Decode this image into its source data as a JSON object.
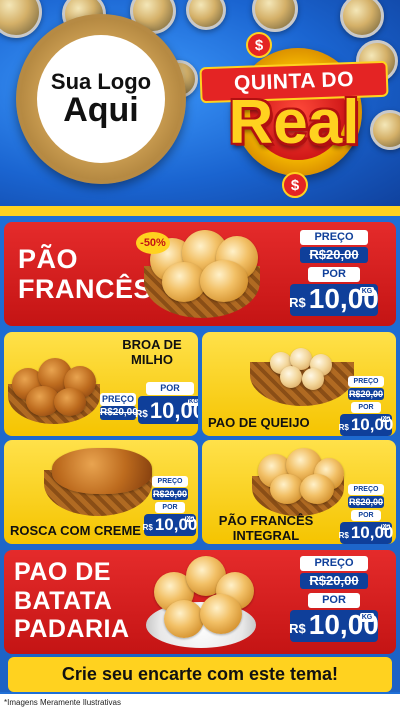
{
  "header": {
    "logo_line1": "Sua Logo",
    "logo_line2": "Aqui",
    "badge_top": "QUINTA DO",
    "badge_main": "Real",
    "badge_symbol": "$"
  },
  "price_labels": {
    "preco": "PREÇO",
    "por": "POR",
    "currency": "R$",
    "unit": "KG"
  },
  "products": {
    "pao_frances": {
      "name_lines": [
        "PÃO",
        "FRANCÊS"
      ],
      "discount": "-50%",
      "old_price": "R$20,00",
      "new_price": "10,00"
    },
    "broa": {
      "name_lines": [
        "BROA DE",
        "MILHO"
      ],
      "old_price": "R$20,00",
      "new_price": "10,00"
    },
    "pao_queijo": {
      "name": "PAO DE QUEIJO",
      "old_price": "R$20,00",
      "new_price": "10,00"
    },
    "rosca": {
      "name": "ROSCA COM CREME",
      "old_price": "R$20,00",
      "new_price": "10,00"
    },
    "frances_integral": {
      "name_lines": [
        "PÃO FRANCÊS",
        "INTEGRAL"
      ],
      "old_price": "R$20,00",
      "new_price": "10,00"
    },
    "batata": {
      "name_lines": [
        "PAO DE",
        "BATATA",
        "PADARIA"
      ],
      "old_price": "R$20,00",
      "new_price": "10,00"
    }
  },
  "footer": {
    "cta": "Crie seu encarte com este tema!",
    "note": "*Imagens Meramente Ilustrativas"
  },
  "colors": {
    "blue": "#1f6fd6",
    "red": "#e52b2b",
    "yellow": "#ffd21f",
    "navy": "#0f3f9a"
  }
}
